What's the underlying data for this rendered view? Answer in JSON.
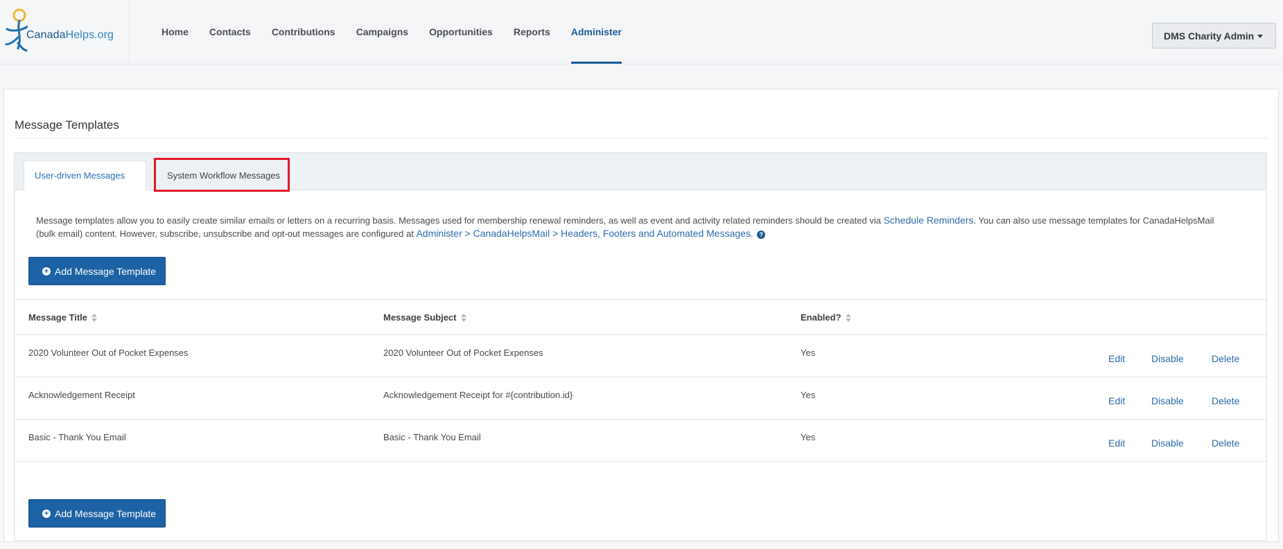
{
  "brand": {
    "name_part1": "Canada",
    "name_part2": "Helps.org"
  },
  "nav": [
    {
      "label": "Home",
      "active": false
    },
    {
      "label": "Contacts",
      "active": false
    },
    {
      "label": "Contributions",
      "active": false
    },
    {
      "label": "Campaigns",
      "active": false
    },
    {
      "label": "Opportunities",
      "active": false
    },
    {
      "label": "Reports",
      "active": false
    },
    {
      "label": "Administer",
      "active": true
    }
  ],
  "user": {
    "label": "DMS Charity Admin"
  },
  "page": {
    "title": "Message Templates"
  },
  "tabs": [
    {
      "label": "User-driven Messages",
      "active": true
    },
    {
      "label": "System Workflow Messages",
      "active": false
    }
  ],
  "description": {
    "part1": "Message templates allow you to easily create similar emails or letters on a recurring basis. Messages used for membership renewal reminders, as well as event and activity related reminders should be created via ",
    "link1": "Schedule Reminders",
    "part2": ". You can also use message templates for CanadaHelpsMail (bulk email) content. However, subscribe, unsubscribe and opt-out messages are configured at ",
    "link2": "Administer > CanadaHelpsMail > Headers, Footers and Automated Messages",
    "part3": "."
  },
  "buttons": {
    "add_template": "Add Message Template"
  },
  "table": {
    "columns": [
      "Message Title",
      "Message Subject",
      "Enabled?"
    ],
    "rows": [
      {
        "title": "2020 Volunteer Out of Pocket Expenses",
        "subject": "2020 Volunteer Out of Pocket Expenses",
        "enabled": "Yes",
        "actions": [
          "Edit",
          "Disable",
          "Delete"
        ]
      },
      {
        "title": "Acknowledgement Receipt",
        "subject": "Acknowledgement Receipt for #{contribution.id}",
        "enabled": "Yes",
        "actions": [
          "Edit",
          "Disable",
          "Delete"
        ]
      },
      {
        "title": "Basic - Thank You Email",
        "subject": "Basic - Thank You Email",
        "enabled": "Yes",
        "actions": [
          "Edit",
          "Disable",
          "Delete"
        ]
      }
    ]
  },
  "colors": {
    "accent": "#1d5c96",
    "button": "#1c62a4",
    "link": "#2d6aa8",
    "highlight": "#e3182a"
  }
}
